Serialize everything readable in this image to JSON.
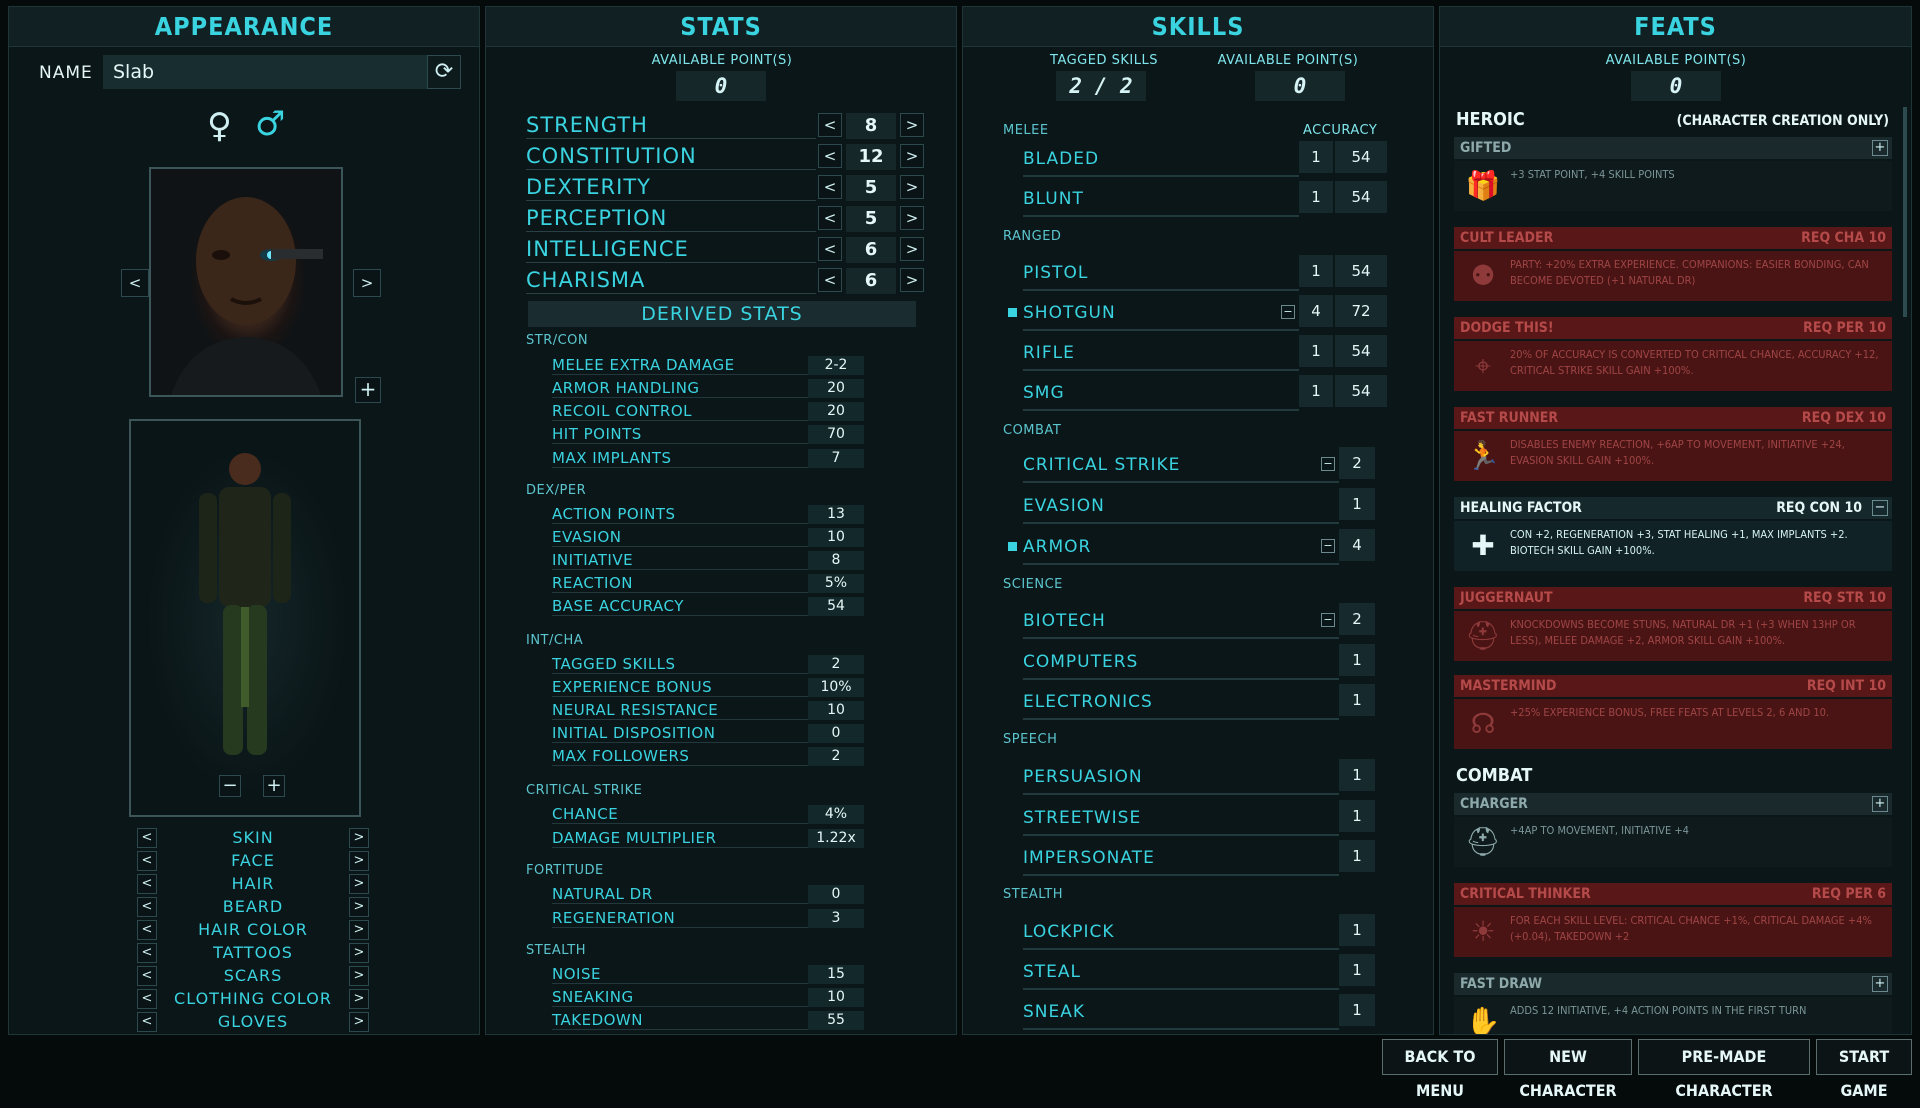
{
  "appearance": {
    "title": "APPEARANCE",
    "name_label": "NAME",
    "name_value": "Slab",
    "options": [
      "SKIN",
      "FACE",
      "HAIR",
      "BEARD",
      "HAIR COLOR",
      "TATTOOS",
      "SCARS",
      "CLOTHING COLOR",
      "GLOVES"
    ]
  },
  "stats": {
    "title": "STATS",
    "available_label": "AVAILABLE POINT(S)",
    "available_value": "0",
    "primary": [
      {
        "label": "STRENGTH",
        "value": "8"
      },
      {
        "label": "CONSTITUTION",
        "value": "12"
      },
      {
        "label": "DEXTERITY",
        "value": "5"
      },
      {
        "label": "PERCEPTION",
        "value": "5"
      },
      {
        "label": "INTELLIGENCE",
        "value": "6"
      },
      {
        "label": "CHARISMA",
        "value": "6"
      }
    ],
    "derived_title": "DERIVED STATS",
    "groups": [
      {
        "name": "STR/CON",
        "rows": [
          {
            "label": "MELEE EXTRA DAMAGE",
            "value": "2-2"
          },
          {
            "label": "ARMOR HANDLING",
            "value": "20"
          },
          {
            "label": "RECOIL CONTROL",
            "value": "20"
          },
          {
            "label": "HIT POINTS",
            "value": "70"
          },
          {
            "label": "MAX IMPLANTS",
            "value": "7"
          }
        ]
      },
      {
        "name": "DEX/PER",
        "rows": [
          {
            "label": "ACTION POINTS",
            "value": "13"
          },
          {
            "label": "EVASION",
            "value": "10"
          },
          {
            "label": "INITIATIVE",
            "value": "8"
          },
          {
            "label": "REACTION",
            "value": "5%"
          },
          {
            "label": "BASE ACCURACY",
            "value": "54"
          }
        ]
      },
      {
        "name": "INT/CHA",
        "rows": [
          {
            "label": "TAGGED SKILLS",
            "value": "2"
          },
          {
            "label": "EXPERIENCE BONUS",
            "value": "10%"
          },
          {
            "label": "NEURAL RESISTANCE",
            "value": "10"
          },
          {
            "label": "INITIAL DISPOSITION",
            "value": "0"
          },
          {
            "label": "MAX FOLLOWERS",
            "value": "2"
          }
        ]
      },
      {
        "name": "CRITICAL STRIKE",
        "rows": [
          {
            "label": "CHANCE",
            "value": "4%"
          },
          {
            "label": "DAMAGE MULTIPLIER",
            "value": "1.22x"
          }
        ]
      },
      {
        "name": "FORTITUDE",
        "rows": [
          {
            "label": "NATURAL DR",
            "value": "0"
          },
          {
            "label": "REGENERATION",
            "value": "3"
          }
        ]
      },
      {
        "name": "STEALTH",
        "rows": [
          {
            "label": "NOISE",
            "value": "15"
          },
          {
            "label": "SNEAKING",
            "value": "10"
          },
          {
            "label": "TAKEDOWN",
            "value": "55"
          }
        ]
      }
    ]
  },
  "skills": {
    "title": "SKILLS",
    "tagged_label": "TAGGED SKILLS",
    "tagged_value": "2 / 2",
    "available_label": "AVAILABLE POINT(S)",
    "available_value": "0",
    "accuracy_label": "ACCURACY",
    "groups": [
      {
        "name": "MELEE",
        "rows": [
          {
            "label": "BLADED",
            "value": "1",
            "accuracy": "54"
          },
          {
            "label": "BLUNT",
            "value": "1",
            "accuracy": "54"
          }
        ]
      },
      {
        "name": "RANGED",
        "rows": [
          {
            "label": "PISTOL",
            "value": "1",
            "accuracy": "54"
          },
          {
            "label": "SHOTGUN",
            "value": "4",
            "accuracy": "72",
            "tagged": true
          },
          {
            "label": "RIFLE",
            "value": "1",
            "accuracy": "54"
          },
          {
            "label": "SMG",
            "value": "1",
            "accuracy": "54"
          }
        ]
      },
      {
        "name": "COMBAT",
        "rows": [
          {
            "label": "CRITICAL STRIKE",
            "value": "2"
          },
          {
            "label": "EVASION",
            "value": "1"
          },
          {
            "label": "ARMOR",
            "value": "4",
            "tagged": true
          }
        ]
      },
      {
        "name": "SCIENCE",
        "rows": [
          {
            "label": "BIOTECH",
            "value": "2"
          },
          {
            "label": "COMPUTERS",
            "value": "1"
          },
          {
            "label": "ELECTRONICS",
            "value": "1"
          }
        ]
      },
      {
        "name": "SPEECH",
        "rows": [
          {
            "label": "PERSUASION",
            "value": "1"
          },
          {
            "label": "STREETWISE",
            "value": "1"
          },
          {
            "label": "IMPERSONATE",
            "value": "1"
          }
        ]
      },
      {
        "name": "STEALTH",
        "rows": [
          {
            "label": "LOCKPICK",
            "value": "1"
          },
          {
            "label": "STEAL",
            "value": "1"
          },
          {
            "label": "SNEAK",
            "value": "1"
          }
        ]
      }
    ]
  },
  "feats": {
    "title": "FEATS",
    "available_label": "AVAILABLE POINT(S)",
    "available_value": "0",
    "heroic_label": "HEROIC",
    "heroic_note": "(CHARACTER CREATION ONLY)",
    "combat_label": "COMBAT",
    "heroic": [
      {
        "name": "GIFTED",
        "req": "",
        "desc": "+3 STAT POINT, +4 SKILL POINTS",
        "state": "open",
        "icon": "gift-icon",
        "glyph": "🎁"
      },
      {
        "name": "CULT LEADER",
        "req": "REQ CHA 10",
        "desc": "PARTY: +20% EXTRA EXPERIENCE. COMPANIONS: EASIER BONDING, CAN BECOME DEVOTED (+1 NATURAL DR)",
        "state": "locked",
        "icon": "people-icon",
        "glyph": "⚉"
      },
      {
        "name": "DODGE THIS!",
        "req": "REQ PER 10",
        "desc": "20% OF ACCURACY IS CONVERTED TO CRITICAL CHANCE, ACCURACY +12, CRITICAL STRIKE SKILL GAIN +100%.",
        "state": "locked",
        "icon": "crosshair-icon",
        "glyph": "⌖"
      },
      {
        "name": "FAST RUNNER",
        "req": "REQ DEX 10",
        "desc": "DISABLES ENEMY REACTION, +6AP TO MOVEMENT, INITIATIVE +24, EVASION SKILL GAIN +100%.",
        "state": "locked",
        "icon": "runner-icon",
        "glyph": "🏃"
      },
      {
        "name": "HEALING FACTOR",
        "req": "REQ CON 10",
        "desc": "CON +2, REGENERATION +3, STAT HEALING +1, MAX IMPLANTS +2. BIOTECH SKILL GAIN +100%.",
        "state": "taken",
        "icon": "medical-cross-icon",
        "glyph": "✚"
      },
      {
        "name": "JUGGERNAUT",
        "req": "REQ STR 10",
        "desc": "KNOCKDOWNS BECOME STUNS, NATURAL DR +1 (+3 WHEN 13HP OR LESS), MELEE DAMAGE +2, ARMOR SKILL GAIN +100%.",
        "state": "locked",
        "icon": "helmet-icon",
        "glyph": "⛑"
      },
      {
        "name": "MASTERMIND",
        "req": "REQ INT 10",
        "desc": "+25% EXPERIENCE BONUS, FREE FEATS AT LEVELS 2, 6 AND 10.",
        "state": "locked",
        "icon": "brain-icon",
        "glyph": "☊"
      }
    ],
    "combat": [
      {
        "name": "CHARGER",
        "req": "",
        "desc": "+4AP TO MOVEMENT, INITIATIVE +4",
        "state": "open",
        "icon": "football-helmet-icon",
        "glyph": "⛑"
      },
      {
        "name": "CRITICAL THINKER",
        "req": "REQ PER 6",
        "desc": "FOR EACH SKILL LEVEL: CRITICAL CHANCE +1%, CRITICAL DAMAGE +4% (+0.04), TAKEDOWN +2",
        "state": "locked",
        "icon": "lightbulb-icon",
        "glyph": "☀"
      },
      {
        "name": "FAST DRAW",
        "req": "",
        "desc": "ADDS 12 INITIATIVE, +4 ACTION POINTS IN THE FIRST TURN",
        "state": "open",
        "icon": "holster-icon",
        "glyph": "✋"
      }
    ]
  },
  "footer": {
    "back": "BACK TO MENU",
    "new": "NEW CHARACTER",
    "premade": "PRE-MADE CHARACTER",
    "start": "START GAME"
  }
}
